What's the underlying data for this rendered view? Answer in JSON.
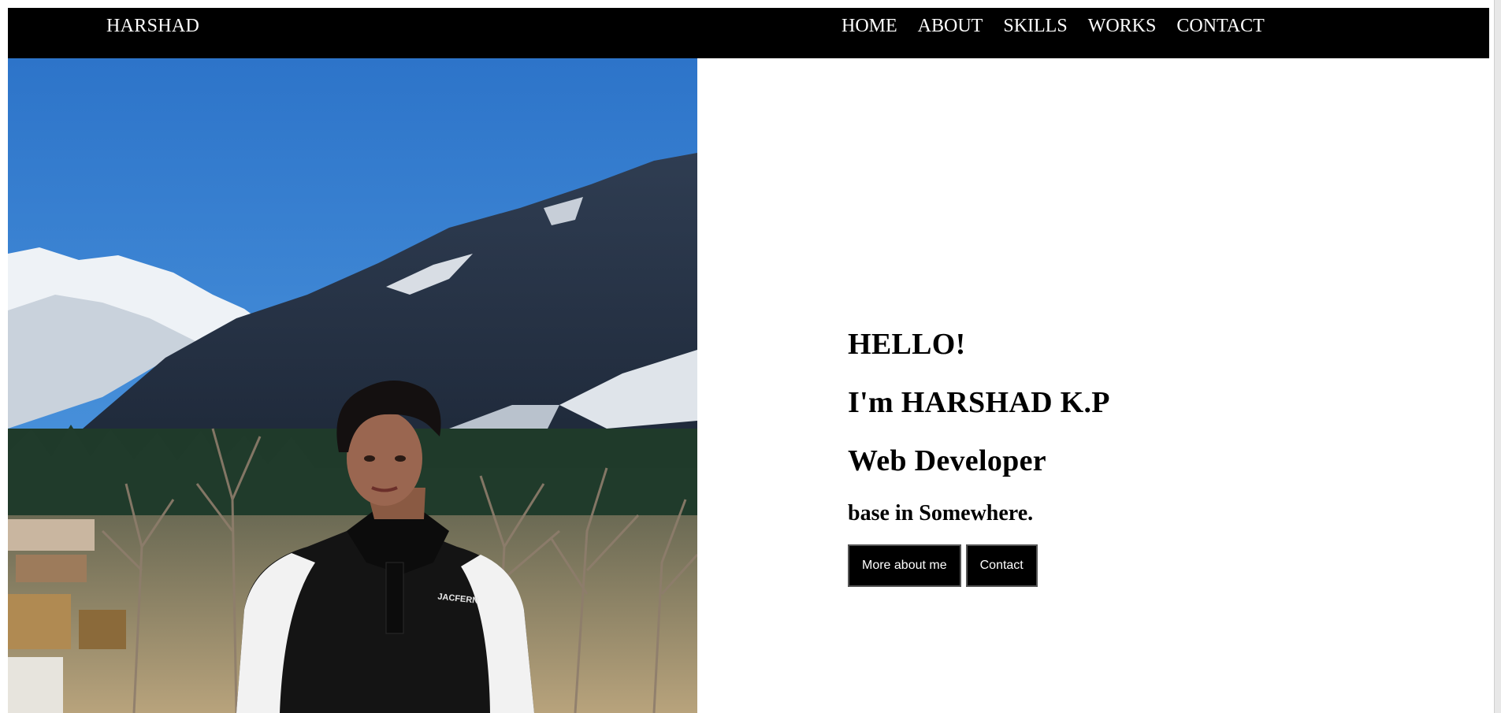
{
  "header": {
    "brand": "HARSHAD",
    "nav": [
      {
        "label": "HOME"
      },
      {
        "label": "ABOUT"
      },
      {
        "label": "SKILLS"
      },
      {
        "label": "WORKS"
      },
      {
        "label": "CONTACT"
      }
    ]
  },
  "hero": {
    "greeting": "HELLO!",
    "name_line": "I'm HARSHAD K.P",
    "role": "Web Developer",
    "location": "base in Somewhere.",
    "buttons": {
      "more": "More about me",
      "contact": "Contact"
    },
    "photo": {
      "sweatshirt_text": "JACFERN"
    }
  },
  "colors": {
    "header_bg": "#000000",
    "header_text": "#ffffff",
    "page_bg": "#ffffff",
    "button_bg": "#000000",
    "button_text": "#ffffff",
    "sky": "#3a8ad8"
  }
}
